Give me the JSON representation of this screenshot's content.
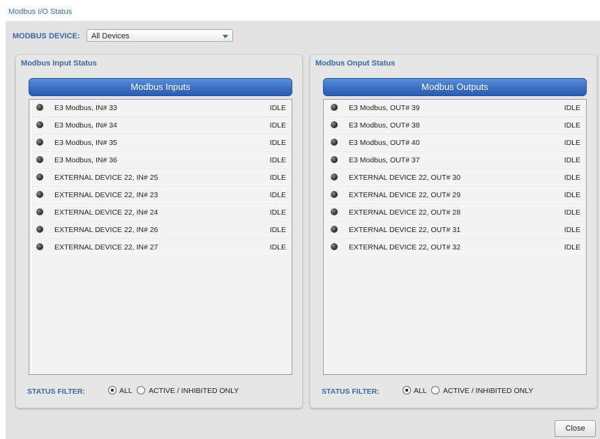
{
  "window": {
    "title": "Modbus I/O Status"
  },
  "device": {
    "label": "MODBUS DEVICE:",
    "selected": "All Devices"
  },
  "inputs": {
    "panel_title": "Modbus Input Status",
    "header": "Modbus Inputs",
    "rows": [
      {
        "name": "E3 Modbus, IN# 33",
        "status": "IDLE"
      },
      {
        "name": "E3 Modbus, IN# 34",
        "status": "IDLE"
      },
      {
        "name": "E3 Modbus, IN# 35",
        "status": "IDLE"
      },
      {
        "name": "E3 Modbus, IN# 36",
        "status": "IDLE"
      },
      {
        "name": "EXTERNAL DEVICE 22, IN# 25",
        "status": "IDLE"
      },
      {
        "name": "EXTERNAL DEVICE 22, IN# 23",
        "status": "IDLE"
      },
      {
        "name": "EXTERNAL DEVICE 22, IN# 24",
        "status": "IDLE"
      },
      {
        "name": "EXTERNAL DEVICE 22, IN# 26",
        "status": "IDLE"
      },
      {
        "name": "EXTERNAL DEVICE 22, IN# 27",
        "status": "IDLE"
      }
    ],
    "filter": {
      "label": "STATUS FILTER:",
      "option_all": "ALL",
      "option_active": "ACTIVE / INHIBITED ONLY",
      "selected": "all"
    }
  },
  "outputs": {
    "panel_title": "Modbus Onput Status",
    "header": "Modbus Outputs",
    "rows": [
      {
        "name": "E3 Modbus, OUT# 39",
        "status": "IDLE"
      },
      {
        "name": "E3 Modbus, OUT# 38",
        "status": "IDLE"
      },
      {
        "name": "E3 Modbus, OUT# 40",
        "status": "IDLE"
      },
      {
        "name": "E3 Modbus, OUT# 37",
        "status": "IDLE"
      },
      {
        "name": "EXTERNAL DEVICE 22, OUT# 30",
        "status": "IDLE"
      },
      {
        "name": "EXTERNAL DEVICE 22, OUT# 29",
        "status": "IDLE"
      },
      {
        "name": "EXTERNAL DEVICE 22, OUT# 28",
        "status": "IDLE"
      },
      {
        "name": "EXTERNAL DEVICE 22, OUT# 31",
        "status": "IDLE"
      },
      {
        "name": "EXTERNAL DEVICE 22, OUT# 32",
        "status": "IDLE"
      }
    ],
    "filter": {
      "label": "STATUS FILTER:",
      "option_all": "ALL",
      "option_active": "ACTIVE / INHIBITED ONLY",
      "selected": "all"
    }
  },
  "footer": {
    "close_label": "Close"
  },
  "colors": {
    "accent": "#3a6aa6",
    "header_blue": "#3e72c6",
    "background": "#e2e2e2"
  }
}
